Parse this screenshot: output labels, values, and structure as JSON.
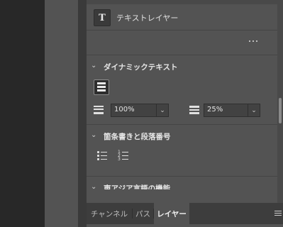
{
  "colors": {
    "panel_bg": "#535353",
    "dark_bg": "#282828",
    "tabs_bg": "#3d3d3d",
    "text": "#e0e0e0"
  },
  "properties": {
    "layer_type_icon": "T",
    "layer_type_label": "テキストレイヤー",
    "more_icon": "more-horizontal-icon",
    "dynamic_text": {
      "title": "ダイナミックテキスト",
      "tracking_value": "100%",
      "leading_value": "25%"
    },
    "bullets": {
      "title": "箇条書きと段落番号"
    },
    "next_section": {
      "title": "東アジア言語の機能"
    }
  },
  "tabs": {
    "items": [
      {
        "label": "チャンネル",
        "active": false
      },
      {
        "label": "パス",
        "active": false
      },
      {
        "label": "レイヤー",
        "active": true
      }
    ],
    "menu_icon": "hamburger-icon"
  },
  "scrollbar": {
    "position": 0.55
  }
}
